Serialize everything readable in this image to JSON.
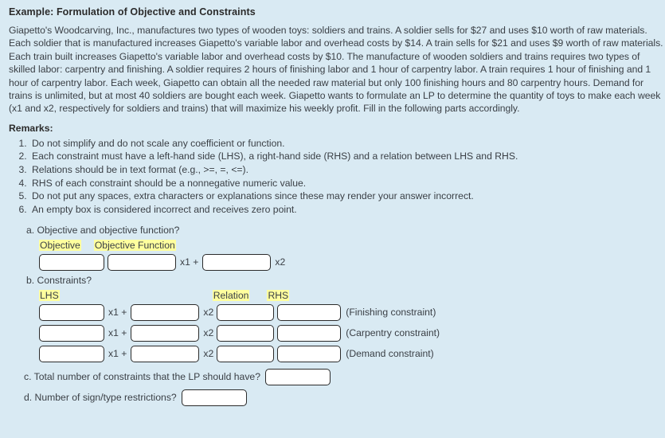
{
  "example": {
    "title": "Example: Formulation of Objective and Constraints",
    "problem_text": "Giapetto's Woodcarving, Inc., manufactures two types of wooden toys: soldiers and trains. A soldier sells for $27 and uses $10 worth of raw materials. Each soldier that is manufactured increases Giapetto's variable labor and overhead costs by $14. A train sells for $21 and uses $9 worth of raw materials. Each train built increases Giapetto's variable labor and overhead costs by $10. The manufacture of wooden soldiers and trains requires two types of skilled labor: carpentry and finishing. A soldier requires 2 hours of finishing labor and 1 hour of carpentry labor. A train requires 1 hour of finishing and 1 hour of carpentry labor. Each week, Giapetto can obtain all the needed raw material but only 100 finishing hours and 80 carpentry hours. Demand for trains is unlimited, but at most 40 soldiers are bought each week. Giapetto wants to formulate an LP to determine the quantity of toys to make each week (x1 and x2, respectively for soldiers and trains) that will maximize his weekly profit. Fill in the following parts accordingly."
  },
  "remarks": {
    "heading": "Remarks:",
    "items": [
      "Do not simplify and do not scale any coefficient or function.",
      "Each constraint must have a left-hand side (LHS), a right-hand side (RHS) and a relation between LHS and RHS.",
      "Relations should be in text format (e.g.,  >=, =, <=).",
      "RHS of each constraint should be a nonnegative numeric value.",
      "Do not put any spaces, extra characters or explanations since these may render your answer incorrect.",
      "An empty box is considered incorrect and receives zero point."
    ]
  },
  "part_a": {
    "question": "a. Objective and objective function?",
    "header_objective": "Objective",
    "header_objective_function": "Objective Function",
    "objective_value": "",
    "objective_placeholder": "",
    "coef_x1_value": "",
    "operator_x1": "x1 +",
    "coef_x2_value": "",
    "operator_x2": "x2"
  },
  "part_b": {
    "question": "b. Constraints?",
    "header_lhs": "LHS",
    "header_relation": "Relation",
    "header_rhs": "RHS",
    "operator_x1": "x1 +",
    "operator_x2": "x2",
    "rows": [
      {
        "coef1": "",
        "coef2": "",
        "relation": "",
        "rhs": "",
        "tag": "(Finishing constraint)"
      },
      {
        "coef1": "",
        "coef2": "",
        "relation": "",
        "rhs": "",
        "tag": "(Carpentry constraint)"
      },
      {
        "coef1": "",
        "coef2": "",
        "relation": "",
        "rhs": "",
        "tag": "(Demand constraint)"
      }
    ]
  },
  "part_c": {
    "question": "c. Total number of constraints that the LP should have?",
    "value": ""
  },
  "part_d": {
    "question": "d. Number of sign/type restrictions?",
    "value": ""
  },
  "colors": {
    "page_background": "#d9eaf3",
    "highlight": "#ffff9e",
    "box_border": "#2b2b2b",
    "box_fill": "#ffffff",
    "text": "#3a3f45"
  }
}
